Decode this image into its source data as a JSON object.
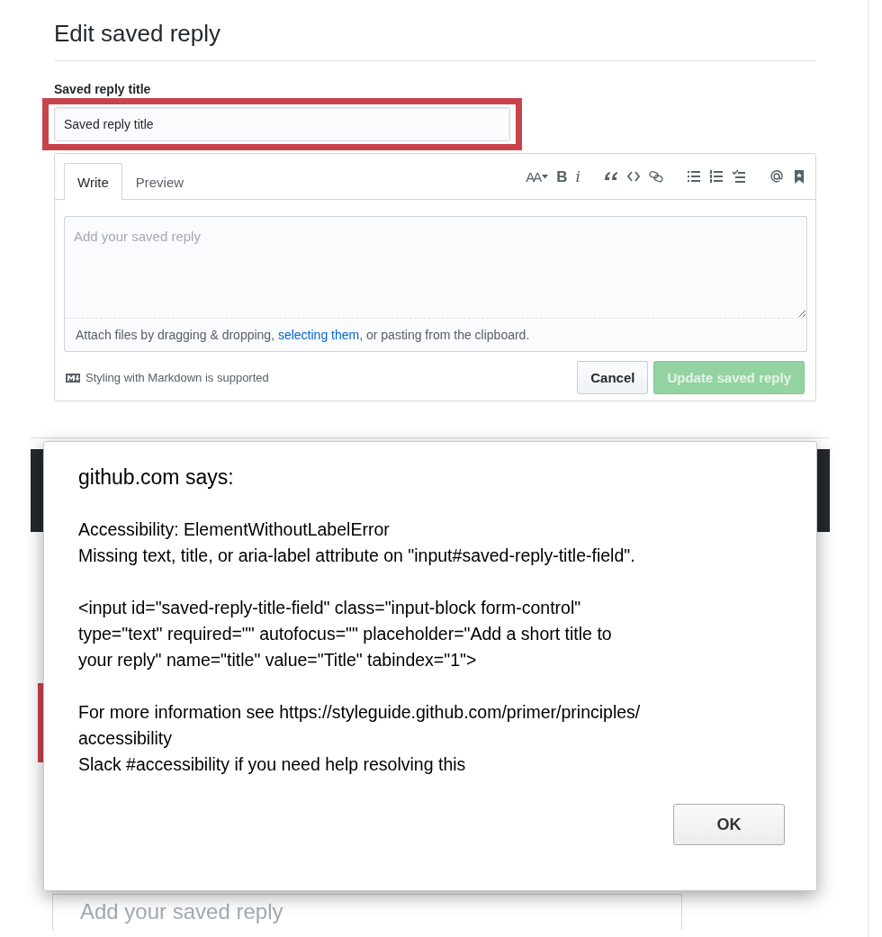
{
  "page": {
    "title": "Edit saved reply",
    "title_field": {
      "label": "Saved reply title",
      "value": "Saved reply title",
      "highlighted": true
    },
    "editor": {
      "tabs": [
        {
          "label": "Write",
          "selected": true
        },
        {
          "label": "Preview",
          "selected": false
        }
      ],
      "toolbar": [
        [
          {
            "kind": "heading",
            "label": "AA"
          },
          {
            "kind": "bold",
            "label": "B"
          },
          {
            "kind": "italic",
            "label": "i"
          }
        ],
        [
          {
            "kind": "quote"
          },
          {
            "kind": "code"
          },
          {
            "kind": "link"
          }
        ],
        [
          {
            "kind": "bullets"
          },
          {
            "kind": "numbers"
          },
          {
            "kind": "tasks"
          }
        ],
        [
          {
            "kind": "mention"
          },
          {
            "kind": "bookmark"
          }
        ]
      ],
      "placeholder": "Add your saved reply",
      "attach": {
        "before": "Attach files by dragging & dropping, ",
        "link": "selecting them",
        "after": ", or pasting from the clipboard."
      },
      "markdown_note": "Styling with Markdown is supported",
      "buttons": [
        {
          "label": "Cancel",
          "kind": "secondary",
          "disabled": false
        },
        {
          "label": "Update saved reply",
          "kind": "primary",
          "disabled": true
        }
      ]
    }
  },
  "background_page": {
    "editor_placeholder": "Add your saved reply"
  },
  "dialog": {
    "title": "github.com says:",
    "paragraphs": [
      [
        "Accessibility: ElementWithoutLabelError",
        "Missing text, title, or aria-label attribute on \"input#saved-reply-title-field\"."
      ],
      [
        "<input id=\"saved-reply-title-field\" class=\"input-block form-control\"",
        "type=\"text\" required=\"\" autofocus=\"\" placeholder=\"Add a short title to",
        "your reply\" name=\"title\" value=\"Title\" tabindex=\"1\">"
      ],
      [
        "For more information see https://styleguide.github.com/primer/principles/",
        "accessibility",
        "Slack #accessibility if you need help resolving this"
      ]
    ],
    "button": "OK"
  }
}
